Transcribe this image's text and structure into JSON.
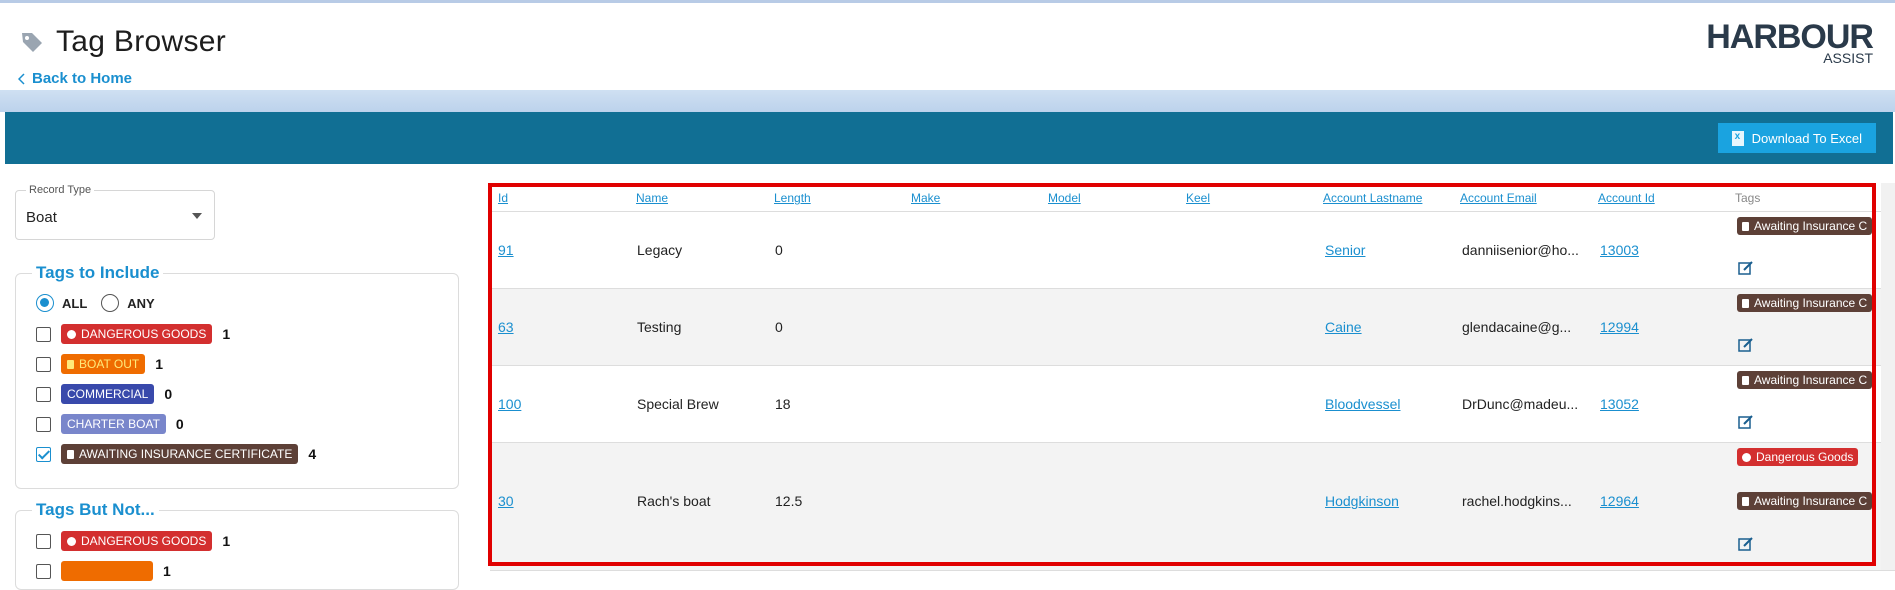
{
  "header": {
    "title": "Tag Browser",
    "back_label": "Back to Home",
    "logo_main": "HARBOUR",
    "logo_sub": "ASSIST"
  },
  "toolbar": {
    "download_label": "Download To Excel"
  },
  "record_type": {
    "label": "Record Type",
    "value": "Boat"
  },
  "tags_include": {
    "legend": "Tags to Include",
    "all_label": "ALL",
    "any_label": "ANY",
    "items": [
      {
        "label": "DANGEROUS GOODS",
        "count": "1",
        "color": "#d32f2f",
        "checked": false
      },
      {
        "label": "BOAT OUT",
        "count": "1",
        "color": "#ef6c00",
        "checked": false
      },
      {
        "label": "COMMERCIAL",
        "count": "0",
        "color": "#3949ab",
        "checked": false
      },
      {
        "label": "CHARTER BOAT",
        "count": "0",
        "color": "#7986cb",
        "checked": false
      },
      {
        "label": "AWAITING INSURANCE CERTIFICATE",
        "count": "4",
        "color": "#5d4037",
        "checked": true
      }
    ]
  },
  "tags_exclude": {
    "legend": "Tags But Not...",
    "items": [
      {
        "label": "DANGEROUS GOODS",
        "count": "1",
        "color": "#d32f2f"
      },
      {
        "label": "",
        "count": "1",
        "color": "#ef6c00"
      }
    ]
  },
  "table": {
    "columns": [
      "Id",
      "Name",
      "Length",
      "Make",
      "Model",
      "Keel",
      "Account Lastname",
      "Account Email",
      "Account Id",
      "Tags"
    ],
    "rows": [
      {
        "id": "91",
        "name": "Legacy",
        "length": "0",
        "make": "",
        "model": "",
        "keel": "",
        "lastname": "Senior",
        "email": "danniisenior@ho...",
        "account_id": "13003",
        "tags": [
          "Awaiting Insurance C"
        ]
      },
      {
        "id": "63",
        "name": "Testing",
        "length": "0",
        "make": "",
        "model": "",
        "keel": "",
        "lastname": "Caine",
        "email": "glendacaine@g...",
        "account_id": "12994",
        "tags": [
          "Awaiting Insurance C"
        ]
      },
      {
        "id": "100",
        "name": "Special Brew",
        "length": "18",
        "make": "",
        "model": "",
        "keel": "",
        "lastname": "Bloodvessel",
        "email": "DrDunc@madeu...",
        "account_id": "13052",
        "tags": [
          "Awaiting Insurance C"
        ]
      },
      {
        "id": "30",
        "name": "Rach's boat",
        "length": "12.5",
        "make": "",
        "model": "",
        "keel": "",
        "lastname": "Hodgkinson",
        "email": "rachel.hodgkins...",
        "account_id": "12964",
        "tags": [
          "Dangerous Goods",
          "Awaiting Insurance C"
        ]
      }
    ]
  },
  "colors": {
    "accent": "#1a8fcf",
    "bar": "#116f94",
    "awaiting": "#5d4037",
    "danger": "#d32f2f",
    "highlight": "#e00000"
  }
}
